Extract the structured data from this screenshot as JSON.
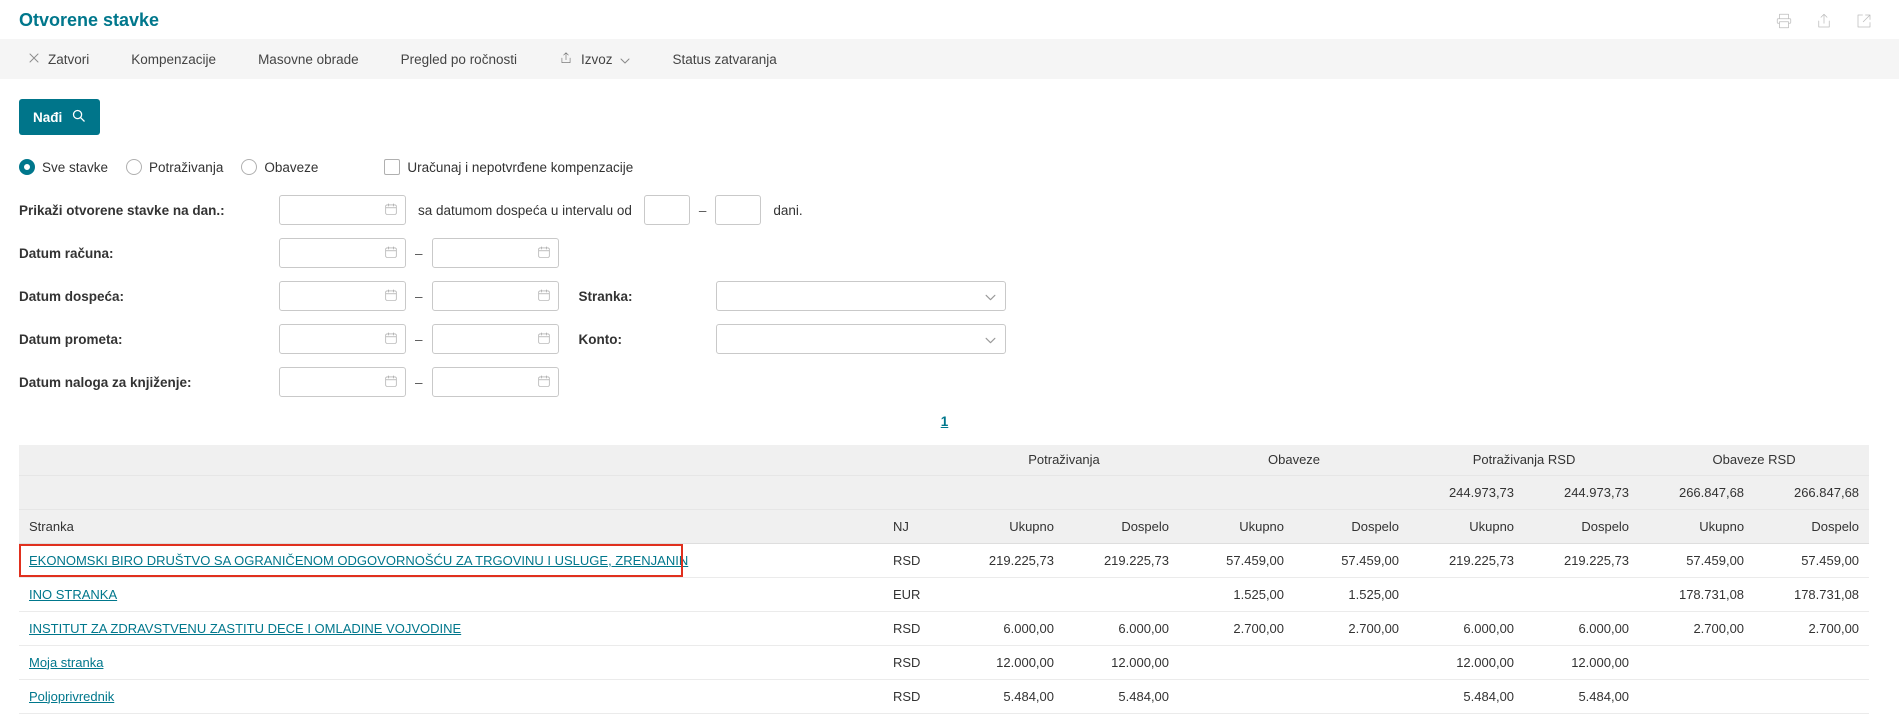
{
  "page": {
    "title": "Otvorene stavke"
  },
  "colors": {
    "accent_teal": "#00778c",
    "button_teal": "#00758a",
    "highlight_red": "#e0301e",
    "toolbar_gray": "#f5f5f5",
    "table_header_gray": "#f0f0f0"
  },
  "icons": {
    "header": [
      "print-icon",
      "share-icon",
      "open-in-new-icon"
    ],
    "toolbar_zatvori": "close-icon",
    "toolbar_izvoz": [
      "export-icon",
      "chevron-down-icon"
    ],
    "find_button": "search-icon",
    "date_inputs": "calendar-icon",
    "selects": "chevron-down-icon"
  },
  "toolbar": {
    "zatvori": "Zatvori",
    "kompenzacije": "Kompenzacije",
    "masovne_obrade": "Masovne obrade",
    "pregled_po_rocnosti": "Pregled po ročnosti",
    "izvoz": "Izvoz",
    "status_zatvaranja": "Status zatvaranja"
  },
  "search": {
    "find_button": "Nađi"
  },
  "options": {
    "radio_sve_stavke": "Sve stavke",
    "radio_potrazivanja": "Potraživanja",
    "radio_obaveze": "Obaveze",
    "selected_radio": "Sve stavke",
    "checkbox_label": "Uračunaj i nepotvrđene kompenzacije",
    "checkbox_checked": false
  },
  "filters": {
    "prikazi_label": "Prikaži otvorene stavke na dan.:",
    "interval_text": "sa datumom dospeća u intervalu od",
    "range_dash": "–",
    "interval_suffix": "dani.",
    "datum_racuna_label": "Datum računa:",
    "datum_dospeca_label": "Datum dospeća:",
    "datum_prometa_label": "Datum prometa:",
    "datum_naloga_label": "Datum naloga za knjiženje:",
    "stranka_label": "Stranka:",
    "konto_label": "Konto:",
    "date_values": {
      "na_dan": "",
      "racuna_od": "",
      "racuna_do": "",
      "dospeca_od": "",
      "dospeca_do": "",
      "prometa_od": "",
      "prometa_do": "",
      "naloga_od": "",
      "naloga_do": "",
      "interval_od": "",
      "interval_do": ""
    },
    "stranka_selected": "",
    "konto_selected": ""
  },
  "pagination": {
    "current_page": "1"
  },
  "table": {
    "group_headers": [
      "Potraživanja",
      "Obaveze",
      "Potraživanja RSD",
      "Obaveze RSD"
    ],
    "totals": [
      "244.973,73",
      "244.973,73",
      "266.847,68",
      "266.847,68"
    ],
    "columns": {
      "stranka": "Stranka",
      "nj": "NJ",
      "ukupno": "Ukupno",
      "dospelo": "Dospelo"
    },
    "rows": [
      {
        "stranka": "EKONOMSKI BIRO DRUŠTVO SA OGRANIČENOM ODGOVORNOŠĆU ZA TRGOVINU I USLUGE, ZRENJANIN",
        "nj": "RSD",
        "highlighted": true,
        "values": [
          "219.225,73",
          "219.225,73",
          "57.459,00",
          "57.459,00",
          "219.225,73",
          "219.225,73",
          "57.459,00",
          "57.459,00"
        ]
      },
      {
        "stranka": "INO STRANKA",
        "nj": "EUR",
        "highlighted": false,
        "values": [
          "",
          "",
          "1.525,00",
          "1.525,00",
          "",
          "",
          "178.731,08",
          "178.731,08"
        ]
      },
      {
        "stranka": "INSTITUT ZA ZDRAVSTVENU ZASTITU DECE I OMLADINE VOJVODINE",
        "nj": "RSD",
        "highlighted": false,
        "values": [
          "6.000,00",
          "6.000,00",
          "2.700,00",
          "2.700,00",
          "6.000,00",
          "6.000,00",
          "2.700,00",
          "2.700,00"
        ]
      },
      {
        "stranka": "Moja stranka",
        "nj": "RSD",
        "highlighted": false,
        "values": [
          "12.000,00",
          "12.000,00",
          "",
          "",
          "12.000,00",
          "12.000,00",
          "",
          ""
        ]
      },
      {
        "stranka": "Poljoprivrednik",
        "nj": "RSD",
        "highlighted": false,
        "values": [
          "5.484,00",
          "5.484,00",
          "",
          "",
          "5.484,00",
          "5.484,00",
          "",
          ""
        ]
      }
    ]
  }
}
